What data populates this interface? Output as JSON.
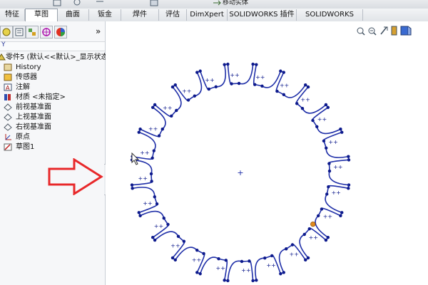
{
  "toolbar": {
    "command_label": "移动实体",
    "tabs": [
      {
        "label": "特征",
        "active": false
      },
      {
        "label": "草图",
        "active": true
      },
      {
        "label": "曲面",
        "active": false
      },
      {
        "label": "钣金",
        "active": false
      },
      {
        "label": "焊件",
        "active": false
      },
      {
        "label": "评估",
        "active": false
      },
      {
        "label": "DimXpert",
        "active": false
      },
      {
        "label": "SOLIDWORKS 插件",
        "active": false
      },
      {
        "label": "SOLIDWORKS MBD",
        "active": false
      }
    ]
  },
  "panel": {
    "tool_icons": [
      "feature-manager-icon",
      "property-manager-icon",
      "configuration-manager-icon",
      "dimxpert-manager-icon",
      "display-manager-icon"
    ],
    "expand_glyph": "»",
    "filter_glyph": "Y",
    "tree": [
      {
        "label": "零件5 (默认<<默认>_显示状态",
        "icon": "part-icon",
        "indent": 0
      },
      {
        "label": "History",
        "icon": "history-icon",
        "indent": 1
      },
      {
        "label": "传感器",
        "icon": "sensor-icon",
        "indent": 1
      },
      {
        "label": "注解",
        "icon": "annotation-icon",
        "indent": 1
      },
      {
        "label": "材质 <未指定>",
        "icon": "material-icon",
        "indent": 1
      },
      {
        "label": "前视基准面",
        "icon": "plane-icon",
        "indent": 1
      },
      {
        "label": "上视基准面",
        "icon": "plane-icon",
        "indent": 1
      },
      {
        "label": "右视基准面",
        "icon": "plane-icon",
        "indent": 1
      },
      {
        "label": "原点",
        "icon": "origin-icon",
        "indent": 1
      },
      {
        "label": "草图1",
        "icon": "sketch-icon",
        "indent": 1
      }
    ]
  },
  "view_toolbar": {
    "icons": [
      "zoom-to-fit-icon",
      "zoom-area-icon",
      "previous-view-icon",
      "section-view-icon",
      "view-orientation-icon"
    ]
  },
  "sketch": {
    "tooth_count": 24,
    "line_color": "#1f2fa8",
    "point_color": "#0d1a8c",
    "highlight_point_color": "#e08a1e",
    "origin_glyph": "+"
  },
  "annotation": {
    "arrow_color": "#e8282a"
  }
}
